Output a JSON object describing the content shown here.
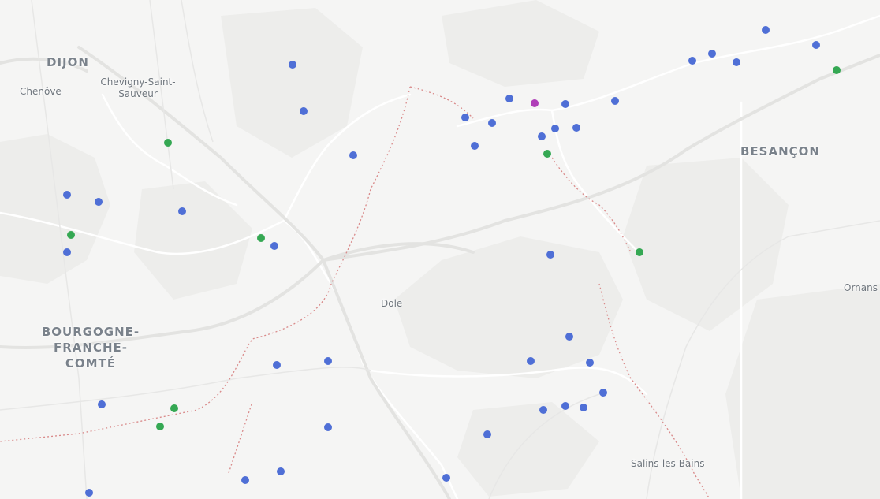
{
  "map": {
    "colors": {
      "background": "#f5f5f4",
      "water": "#ffffff",
      "border": "#d98a8a",
      "marker_blue": "#4f6fd6",
      "marker_green": "#35a853",
      "marker_purple": "#b03fb8"
    },
    "labels": {
      "dijon": "DIJON",
      "chenove": "Chenôve",
      "chevigny_line1": "Chevigny-Saint-",
      "chevigny_line2": "Sauveur",
      "besancon": "BESANÇON",
      "region_line1": "BOURGOGNE-",
      "region_line2": "FRANCHE-",
      "region_line3": "COMTÉ",
      "dole": "Dole",
      "ornans": "Ornans",
      "salins": "Salins-les-Bains"
    }
  }
}
